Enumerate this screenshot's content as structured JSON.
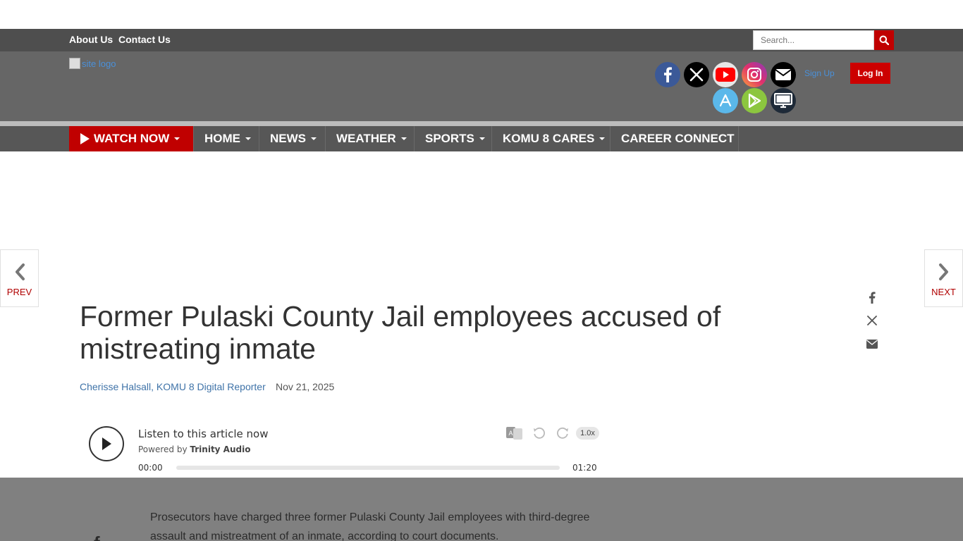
{
  "topbar": {
    "about_label": "About Us",
    "contact_label": "Contact Us",
    "search_placeholder": "Search..."
  },
  "header": {
    "logo_alt": "site logo",
    "signup_label": "Sign Up",
    "login_label": "Log In",
    "social_icons": [
      "facebook-icon",
      "x-icon",
      "youtube-icon",
      "instagram-icon",
      "email-icon",
      "app-store-icon",
      "google-play-icon",
      "tv-icon"
    ]
  },
  "nav": {
    "items": [
      {
        "label": "WATCH NOW"
      },
      {
        "label": "HOME"
      },
      {
        "label": "NEWS"
      },
      {
        "label": "WEATHER"
      },
      {
        "label": "SPORTS"
      },
      {
        "label": "KOMU 8 CARES"
      },
      {
        "label": "CAREER CONNECT"
      }
    ]
  },
  "pager": {
    "prev_label": "PREV",
    "next_label": "NEXT"
  },
  "article": {
    "headline": "Former Pulaski County Jail employees accused of mistreating inmate",
    "author": "Cherisse Halsall, KOMU 8 Digital Reporter",
    "date": "Nov 21, 2025",
    "body_first_paragraph": "Prosecutors have charged three former Pulaski County Jail employees with third-degree assault and mistreatment of an inmate, according to court documents."
  },
  "audio": {
    "listen_label": "Listen to this article now",
    "powered_prefix": "Powered by",
    "powered_brand": "Trinity Audio",
    "time_current": "00:00",
    "time_total": "01:20",
    "speed": "1.0x",
    "progress": 0
  },
  "colors": {
    "brand_red": "#c00000",
    "link_blue": "#3f73a8",
    "header_gray": "#666666"
  }
}
